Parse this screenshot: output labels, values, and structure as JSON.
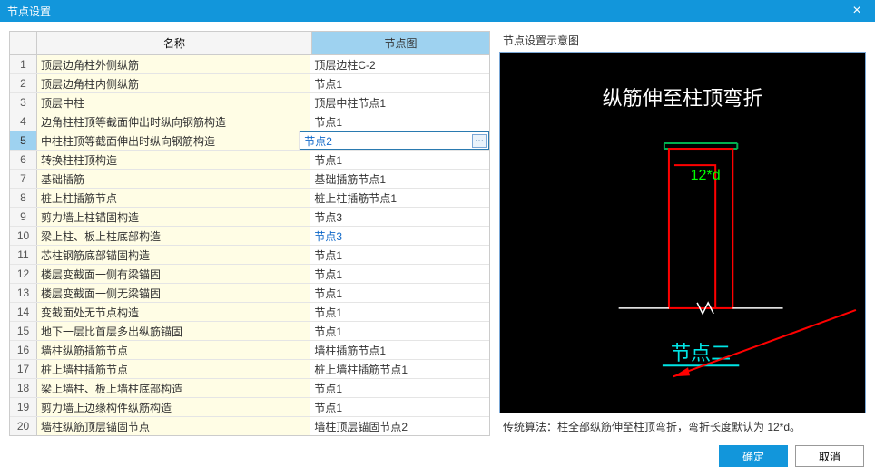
{
  "window": {
    "title": "节点设置",
    "close_glyph": "×"
  },
  "table": {
    "col_name": "名称",
    "col_diagram": "节点图",
    "rows": [
      {
        "n": 1,
        "name": "顶层边角柱外侧纵筋",
        "diagram": "顶层边柱C-2"
      },
      {
        "n": 2,
        "name": "顶层边角柱内侧纵筋",
        "diagram": "节点1"
      },
      {
        "n": 3,
        "name": "顶层中柱",
        "diagram": "顶层中柱节点1"
      },
      {
        "n": 4,
        "name": "边角柱柱顶等截面伸出时纵向钢筋构造",
        "diagram": "节点1"
      },
      {
        "n": 5,
        "name": "中柱柱顶等截面伸出时纵向钢筋构造",
        "diagram": "节点2",
        "selected": true,
        "edited": true
      },
      {
        "n": 6,
        "name": "转换柱柱顶构造",
        "diagram": "节点1"
      },
      {
        "n": 7,
        "name": "基础插筋",
        "diagram": "基础插筋节点1"
      },
      {
        "n": 8,
        "name": "桩上柱插筋节点",
        "diagram": "桩上柱插筋节点1"
      },
      {
        "n": 9,
        "name": "剪力墙上柱锚固构造",
        "diagram": "节点3"
      },
      {
        "n": 10,
        "name": "梁上柱、板上柱底部构造",
        "diagram": "节点3",
        "edited": true
      },
      {
        "n": 11,
        "name": "芯柱钢筋底部锚固构造",
        "diagram": "节点1"
      },
      {
        "n": 12,
        "name": "楼层变截面一侧有梁锚固",
        "diagram": "节点1"
      },
      {
        "n": 13,
        "name": "楼层变截面一侧无梁锚固",
        "diagram": "节点1"
      },
      {
        "n": 14,
        "name": "变截面处无节点构造",
        "diagram": "节点1"
      },
      {
        "n": 15,
        "name": "地下一层比首层多出纵筋锚固",
        "diagram": "节点1"
      },
      {
        "n": 16,
        "name": "墙柱纵筋插筋节点",
        "diagram": "墙柱插筋节点1"
      },
      {
        "n": 17,
        "name": "桩上墙柱插筋节点",
        "diagram": "桩上墙柱插筋节点1"
      },
      {
        "n": 18,
        "name": "梁上墙柱、板上墙柱底部构造",
        "diagram": "节点1"
      },
      {
        "n": 19,
        "name": "剪力墙上边缘构件纵筋构造",
        "diagram": "节点1"
      },
      {
        "n": 20,
        "name": "墙柱纵筋顶层锚固节点",
        "diagram": "墙柱顶层锚固节点2"
      }
    ],
    "more_glyph": "⋯"
  },
  "diagram": {
    "group_title": "节点设置示意图",
    "title": "纵筋伸至柱顶弯折",
    "dimension_label": "12*d",
    "caption": "节点二",
    "note": "传统算法：柱全部纵筋伸至柱顶弯折，弯折长度默认为 12*d。"
  },
  "footer": {
    "ok": "确定",
    "cancel": "取消"
  }
}
